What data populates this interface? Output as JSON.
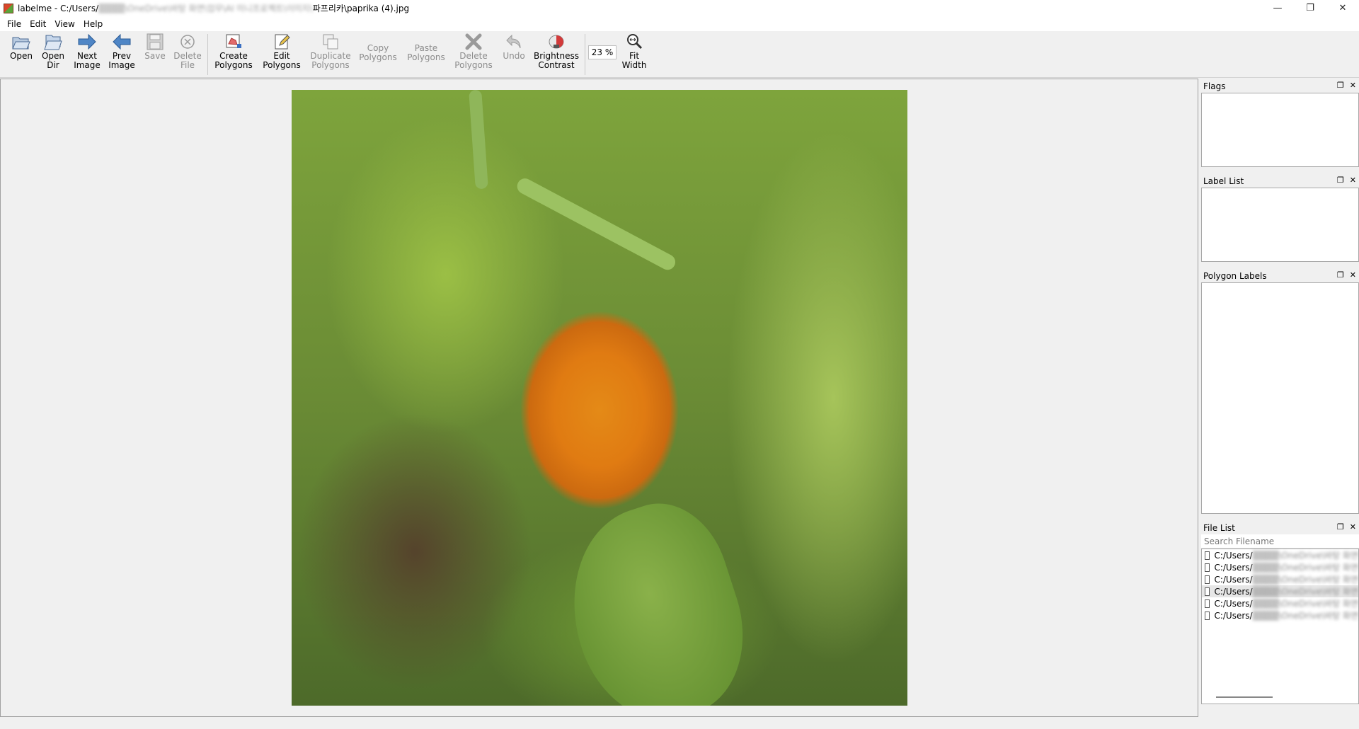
{
  "window": {
    "app_name": "labelme - C:/Users/",
    "path_blurred": "▒▒▒▒\\OneDrive\\바탕 화면\\업무\\AI 미니프로젝트\\이미지\\",
    "path_end": "파프리카\\paprika (4).jpg",
    "controls": {
      "minimize": "—",
      "restore": "❐",
      "close": "✕"
    }
  },
  "menu": [
    "File",
    "Edit",
    "View",
    "Help"
  ],
  "toolbar": {
    "open": "Open",
    "open_dir": "Open\nDir",
    "next_image": "Next\nImage",
    "prev_image": "Prev\nImage",
    "save": "Save",
    "delete_file": "Delete\nFile",
    "create_polygons": "Create\nPolygons",
    "edit_polygons": "Edit\nPolygons",
    "duplicate_polygons": "Duplicate\nPolygons",
    "copy_polygons": "Copy\nPolygons",
    "paste_polygons": "Paste\nPolygons",
    "delete_polygons": "Delete\nPolygons",
    "undo": "Undo",
    "brightness_contrast": "Brightness\nContrast",
    "zoom_value": "23 %",
    "fit_width": "Fit\nWidth"
  },
  "docks": {
    "flags": "Flags",
    "label_list": "Label List",
    "polygon_labels": "Polygon Labels",
    "file_list": "File List",
    "search_placeholder": "Search Filename",
    "float_icon": "❐",
    "close_icon": "✕"
  },
  "file_list": [
    {
      "prefix": "C:/Users/",
      "rest": "▒▒▒▒\\OneDrive\\바탕 화면"
    },
    {
      "prefix": "C:/Users/",
      "rest": "▒▒▒▒\\OneDrive\\바탕 화면"
    },
    {
      "prefix": "C:/Users/",
      "rest": "▒▒▒▒\\OneDrive\\바탕 화면"
    },
    {
      "prefix": "C:/Users/",
      "rest": "▒▒▒▒\\OneDrive\\바탕 화면"
    },
    {
      "prefix": "C:/Users/",
      "rest": "▒▒▒▒\\OneDrive\\바탕 화면"
    },
    {
      "prefix": "C:/Users/",
      "rest": "▒▒▒▒\\OneDrive\\바탕 화면"
    }
  ]
}
